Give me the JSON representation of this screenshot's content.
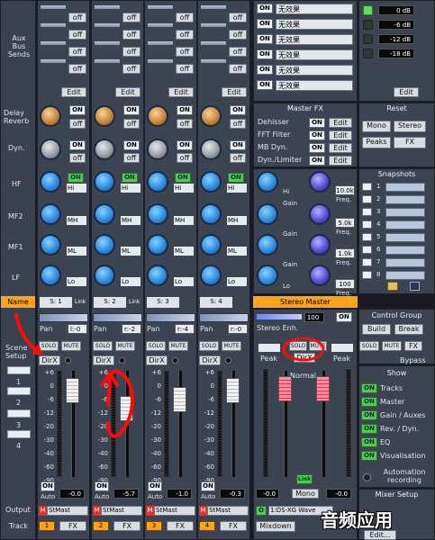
{
  "aux": {
    "label": "Aux\nBus\nSends",
    "btn": "off",
    "edit": "Edit"
  },
  "delay": {
    "label": "Delay\nReverb",
    "on": "ON",
    "off": "off"
  },
  "dyn": {
    "label": "Dyn.",
    "on": "ON",
    "off": "off"
  },
  "eq": {
    "bands": [
      "HF",
      "MF2",
      "MF1",
      "LF"
    ],
    "tags": [
      "Hi",
      "MH",
      "ML",
      "Lo"
    ],
    "on": "ON"
  },
  "name_row": {
    "label": "Name",
    "link": "Link"
  },
  "channels": [
    {
      "name": "S: 1",
      "pan": "l:-0",
      "track": "1",
      "level": "-0.0",
      "output": "StMast",
      "m": "M"
    },
    {
      "name": "S: 2",
      "pan": "r:-2",
      "track": "2",
      "level": "-5.7",
      "output": "StMast",
      "m": "M"
    },
    {
      "name": "S: 3",
      "pan": "r:-4",
      "track": "3",
      "level": "-1.0",
      "output": "StMast",
      "m": "M"
    },
    {
      "name": "S: 4",
      "pan": "r:-0",
      "track": "4",
      "level": "-0.3",
      "output": "StMast",
      "m": "M"
    }
  ],
  "strip": {
    "pan": "Pan",
    "solo": "SOLO",
    "mute": "MUTE",
    "dirx": "DirX",
    "on": "ON",
    "auto": "Auto",
    "fx": "FX"
  },
  "scene": {
    "label": "Scene\nSetup",
    "numbers": [
      "1",
      "2",
      "3",
      "4"
    ]
  },
  "fader_scale": [
    "+6",
    "0",
    "-6",
    "-12",
    "-20",
    "-30",
    "-40",
    "-60",
    "-90"
  ],
  "left_bottom": {
    "output": "Output",
    "track": "Track"
  },
  "fx_slots": {
    "on": "ON",
    "effect": "无效果",
    "levels": [
      "0 dB",
      "-6 dB",
      "-12 dB",
      "-18 dB"
    ],
    "edit": "Edit"
  },
  "master_fx": {
    "title": "Master FX",
    "items": [
      "Dehisser",
      "FFT Filter",
      "MB Dyn.",
      "Dyn./Limiter"
    ],
    "on": "ON",
    "edit": "Edit",
    "gain": "Gain",
    "freq": "Freq.",
    "freq_values": [
      "10.0k",
      "5.0k",
      "1.0k",
      "100"
    ],
    "tags": [
      "Hi",
      "Gain",
      "Gain",
      "Gain",
      "Lo"
    ]
  },
  "stereo_master": {
    "title": "Stereo Master",
    "enh_label": "Stereo Enh.",
    "enh_value": "100",
    "on": "ON",
    "solo": "SOLO",
    "mute": "MUTE",
    "dirx": "DirX",
    "peak": "Peak",
    "normal": "Normal",
    "link": "Link",
    "level_l": "-0.0",
    "level_r": "-0.0",
    "mono": "Mono",
    "o": "O",
    "device": "1:DS-XG Wave",
    "mixdown": "Mixdown"
  },
  "reset": {
    "title": "Reset",
    "mono": "Mono",
    "stereo": "Stereo",
    "peaks": "Peaks",
    "fx": "FX"
  },
  "snapshots": {
    "title": "Snapshots",
    "numbers": [
      "1",
      "2",
      "3",
      "4",
      "5",
      "6",
      "7",
      "8"
    ]
  },
  "control_group": {
    "title": "Control Group",
    "build": "Build",
    "break": "Break",
    "solo": "SOLO",
    "mute": "MUTE",
    "fx": "FX",
    "bypass": "Bypass"
  },
  "show": {
    "title": "Show",
    "on": "ON",
    "items": [
      "Tracks",
      "Master",
      "Gain / Auxes",
      "Rev. / Dyn.",
      "EQ",
      "Visualisation"
    ],
    "automation": "Automation\nrecording"
  },
  "mixer_setup": {
    "title": "Mixer Setup",
    "edit": "Edit..."
  },
  "watermark": "音频应用"
}
